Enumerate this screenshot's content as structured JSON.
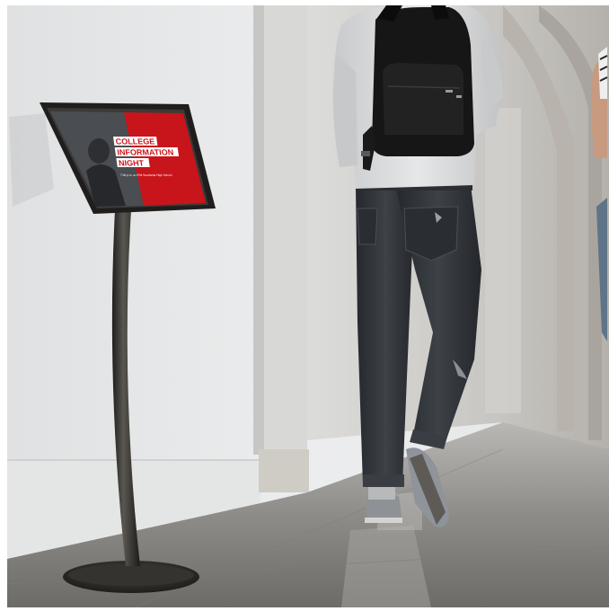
{
  "photo": {
    "poster": {
      "headline_line1": "COLLEGE",
      "headline_line2": "INFORMATION",
      "headline_line3": "NIGHT",
      "subline": "7:00 p.m. at 1PM Southside High School"
    },
    "colors": {
      "wall": "#e9eaea",
      "floor": "#8f8e8c",
      "poster_red": "#c8151b",
      "stand": "#2b2a28",
      "jeans": "#2f3338",
      "shirt": "#d9dadb",
      "backpack": "#161616"
    }
  }
}
